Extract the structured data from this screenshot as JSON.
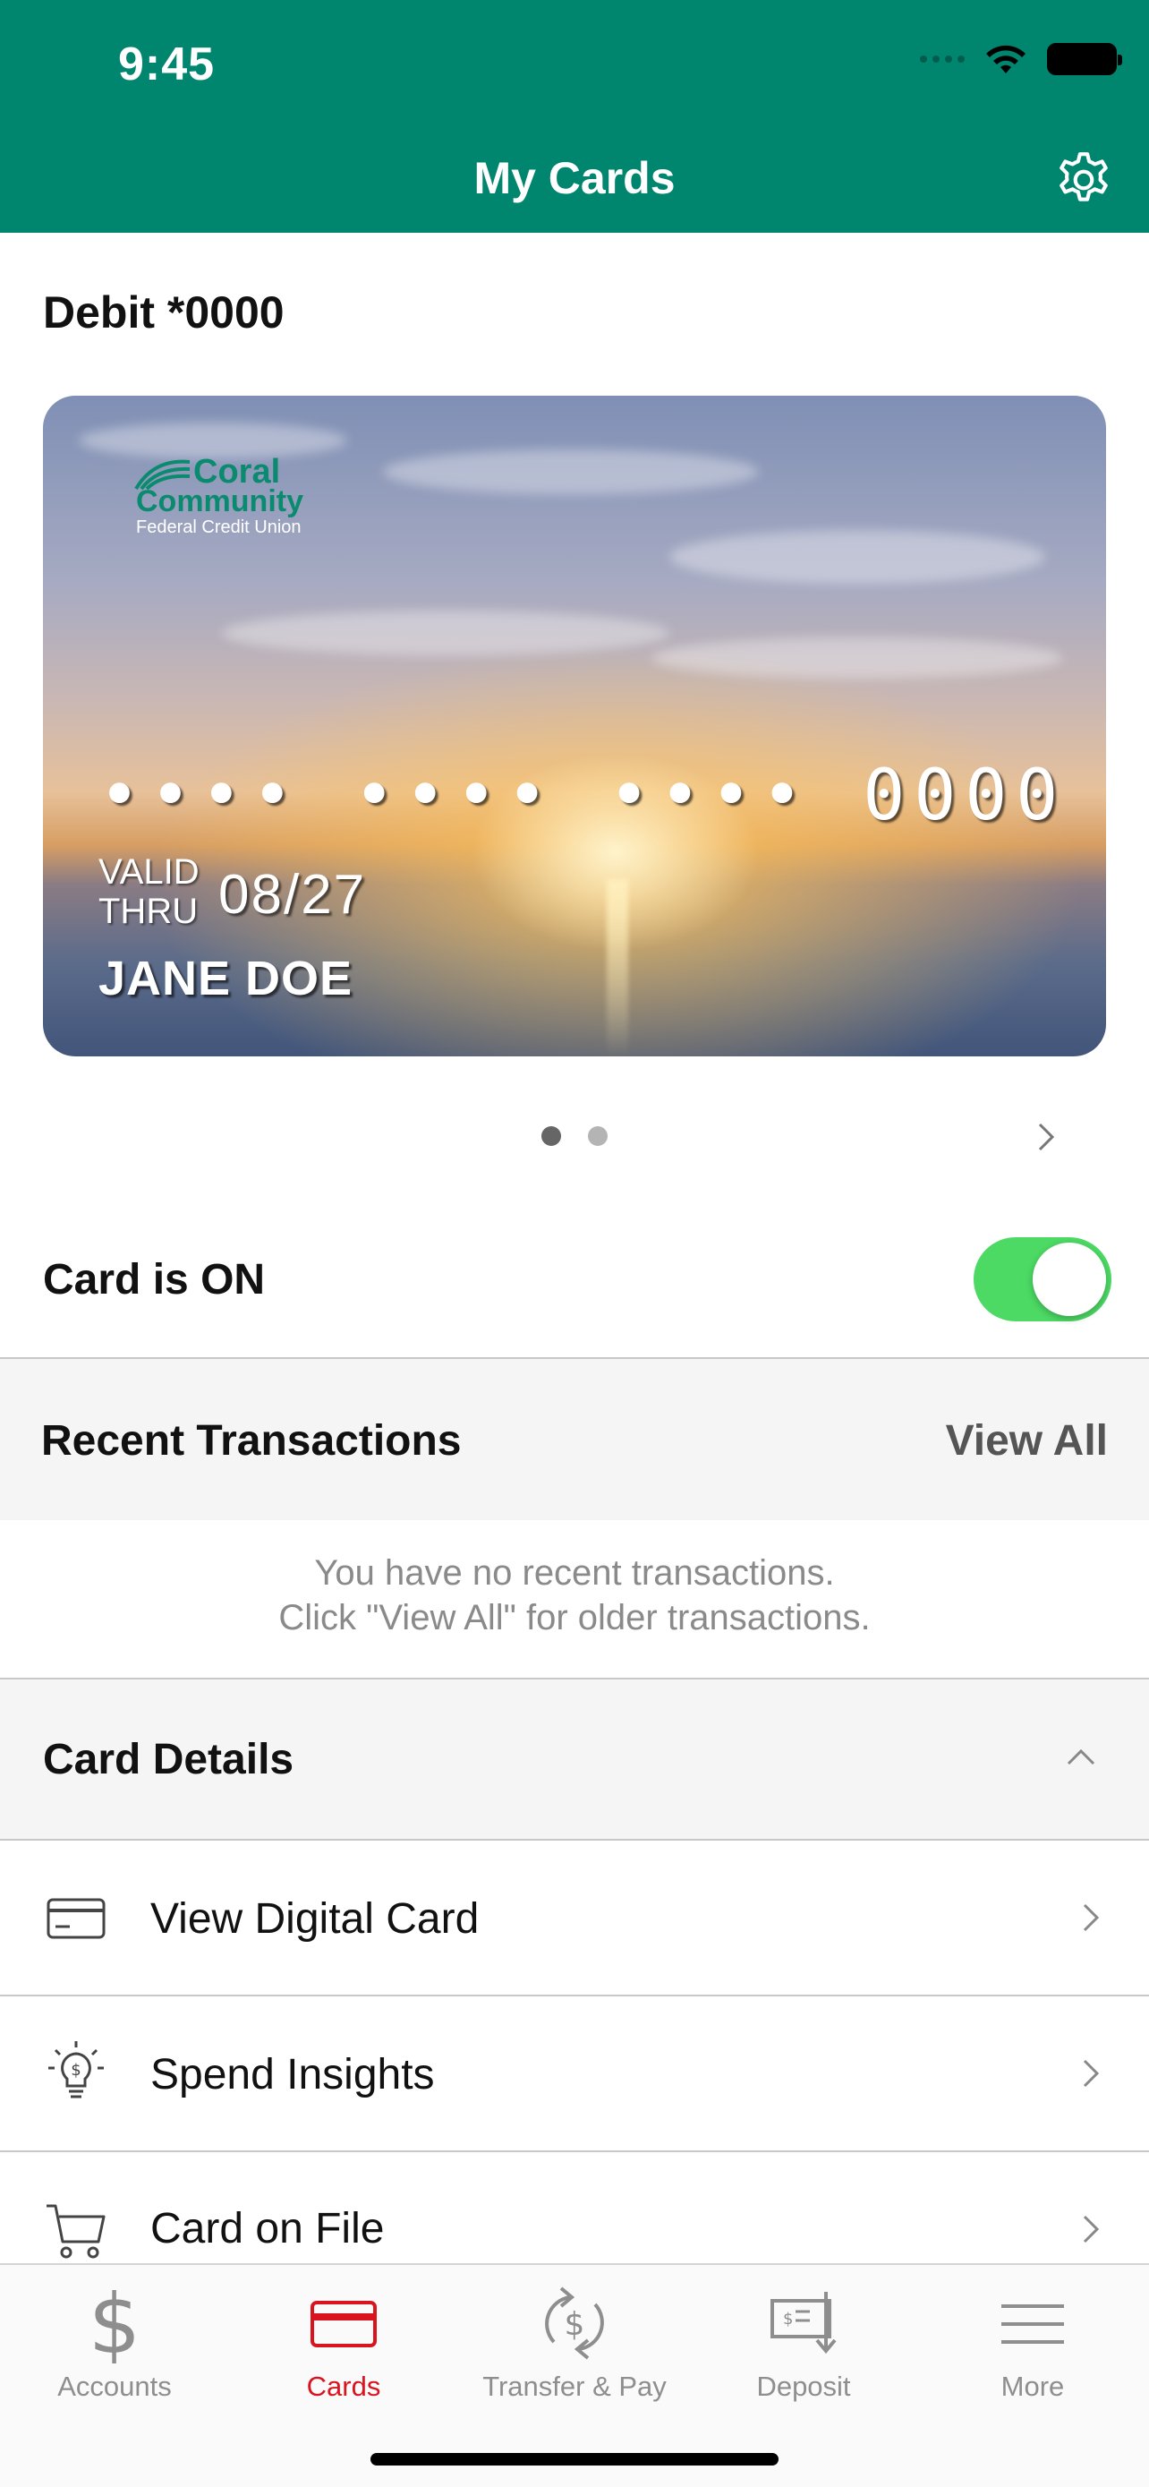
{
  "status_bar": {
    "time": "9:45"
  },
  "header": {
    "title": "My Cards"
  },
  "card": {
    "label": "Debit *0000",
    "logo": {
      "line1": "Coral",
      "line2": "Community",
      "line3": "Federal Credit Union"
    },
    "masked_number": "•••• •••• •••• 0000",
    "valid_line1": "VALID",
    "valid_line2": "THRU",
    "expiry": "08/27",
    "holder": "JANE DOE",
    "pager": {
      "count": 2,
      "active_index": 0
    }
  },
  "card_toggle": {
    "label": "Card is ON",
    "on": true,
    "on_color": "#4cd964"
  },
  "recent_transactions": {
    "title": "Recent Transactions",
    "view_all": "View All",
    "empty_line1": "You have no recent transactions.",
    "empty_line2": "Click \"View All\" for older transactions."
  },
  "card_details": {
    "title": "Card Details",
    "items": [
      {
        "label": "View Digital Card",
        "icon": "credit-card-icon"
      },
      {
        "label": "Spend Insights",
        "icon": "lightbulb-dollar-icon"
      },
      {
        "label": "Card on File",
        "icon": "shopping-cart-icon"
      }
    ]
  },
  "tabbar": {
    "tabs": [
      {
        "label": "Accounts",
        "icon": "dollar-icon",
        "active": false
      },
      {
        "label": "Cards",
        "icon": "card-icon",
        "active": true
      },
      {
        "label": "Transfer & Pay",
        "icon": "transfer-icon",
        "active": false
      },
      {
        "label": "Deposit",
        "icon": "check-deposit-icon",
        "active": false
      },
      {
        "label": "More",
        "icon": "hamburger-icon",
        "active": false
      }
    ]
  },
  "colors": {
    "brand": "#00856f",
    "active_tab": "#d9141e",
    "inactive_tab": "#8e8e8e"
  }
}
